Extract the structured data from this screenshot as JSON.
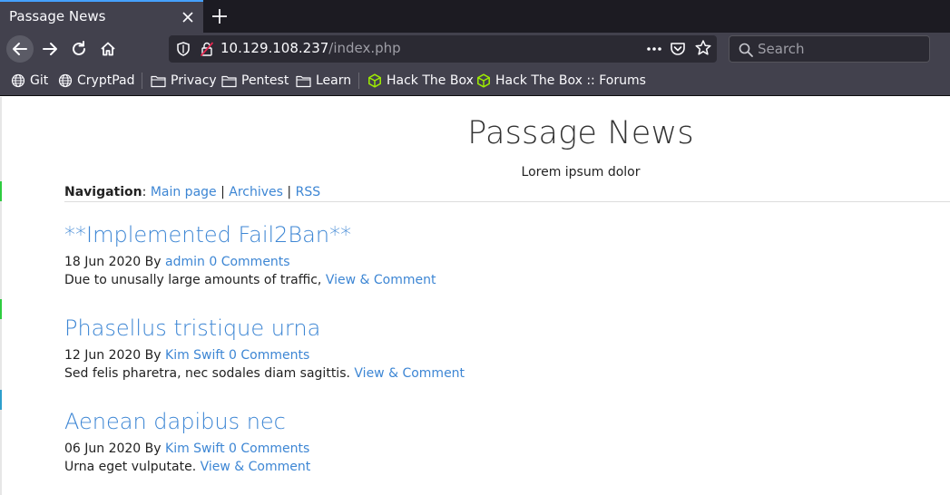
{
  "browser": {
    "tab": {
      "title": "Passage News"
    },
    "url": {
      "host": "10.129.108.237",
      "path": "/index.php"
    },
    "search": {
      "placeholder": "Search"
    },
    "bookmarks": [
      {
        "label": "Git",
        "icon": "globe-icon"
      },
      {
        "label": "CryptPad",
        "icon": "globe-icon"
      },
      {
        "label": "Privacy",
        "icon": "folder-icon"
      },
      {
        "label": "Pentest",
        "icon": "folder-icon"
      },
      {
        "label": "Learn",
        "icon": "folder-icon"
      },
      {
        "label": "Hack The Box",
        "icon": "htb-cube-icon"
      },
      {
        "label": "Hack The Box :: Forums",
        "icon": "htb-cube-icon"
      }
    ],
    "colors": {
      "chrome": "#42414d",
      "tabstrip": "#1c1b22",
      "accent": "#45a1ff",
      "htb_green": "#9fef00"
    }
  },
  "page": {
    "title": "Passage News",
    "subtitle": "Lorem ipsum dolor",
    "nav": {
      "label": "Navigation",
      "colon": ":",
      "sep": "|",
      "links": [
        "Main page",
        "Archives",
        "RSS"
      ]
    },
    "posts": [
      {
        "title": "**Implemented Fail2Ban**",
        "date": "18 Jun 2020",
        "by": "By",
        "author": "admin",
        "comments": "0 Comments",
        "excerpt": "Due to unusally large amounts of traffic,",
        "more": "View & Comment"
      },
      {
        "title": "Phasellus tristique urna",
        "date": "12 Jun 2020",
        "by": "By",
        "author": "Kim Swift",
        "comments": "0 Comments",
        "excerpt": "Sed felis pharetra, nec sodales diam sagittis.",
        "more": "View & Comment"
      },
      {
        "title": "Aenean dapibus nec",
        "date": "06 Jun 2020",
        "by": "By",
        "author": "Kim Swift",
        "comments": "0 Comments",
        "excerpt": "Urna eget vulputate.",
        "more": "View & Comment"
      }
    ],
    "colors": {
      "link": "#3d86d4",
      "text": "#222222"
    }
  }
}
